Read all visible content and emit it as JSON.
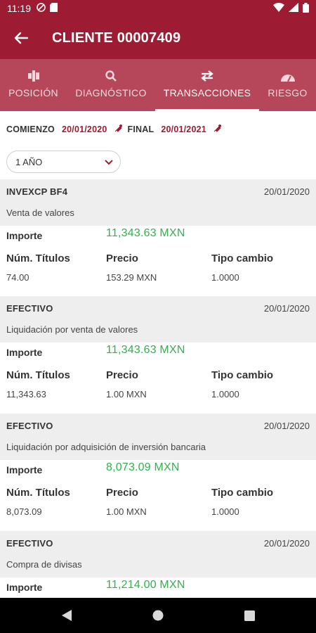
{
  "status_bar": {
    "time": "11:19"
  },
  "app_bar": {
    "title": "CLIENTE 00007409"
  },
  "tabs": [
    {
      "label": "POSICIÓN",
      "icon": "position-icon"
    },
    {
      "label": "DIAGNÓSTICO",
      "icon": "search-icon"
    },
    {
      "label": "TRANSACCIONES",
      "icon": "swap-icon",
      "active": true
    },
    {
      "label": "RIESGO",
      "icon": "gauge-icon"
    }
  ],
  "filters": {
    "start_label": "COMIENZO",
    "start_date": "20/01/2020",
    "end_label": "FINAL",
    "end_date": "20/01/2021",
    "period": "1 AÑO"
  },
  "labels": {
    "importe": "Importe",
    "num_titulos": "Núm. Títulos",
    "precio": "Precio",
    "tipo_cambio": "Tipo cambio"
  },
  "transactions": [
    {
      "name": "INVEXCP BF4",
      "date": "20/01/2020",
      "description": "Venta de valores",
      "importe": "11,343.63 MXN",
      "num_titulos": "74.00",
      "precio": "153.29 MXN",
      "tipo_cambio": "1.0000"
    },
    {
      "name": "EFECTIVO",
      "date": "20/01/2020",
      "description": "Liquidación por venta de valores",
      "importe": "11,343.63 MXN",
      "num_titulos": "11,343.63",
      "precio": "1.00 MXN",
      "tipo_cambio": "1.0000"
    },
    {
      "name": "EFECTIVO",
      "date": "20/01/2020",
      "description": "Liquidación por adquisición de inversión bancaria",
      "importe": "8,073.09 MXN",
      "num_titulos": "8,073.09",
      "precio": "1.00 MXN",
      "tipo_cambio": "1.0000"
    },
    {
      "name": "EFECTIVO",
      "date": "20/01/2020",
      "description": "Compra de divisas",
      "importe": "11,214.00 MXN"
    }
  ],
  "colors": {
    "primary": "#9e1c33",
    "tabs_bg": "#b6475a",
    "positive": "#2fb34a"
  }
}
